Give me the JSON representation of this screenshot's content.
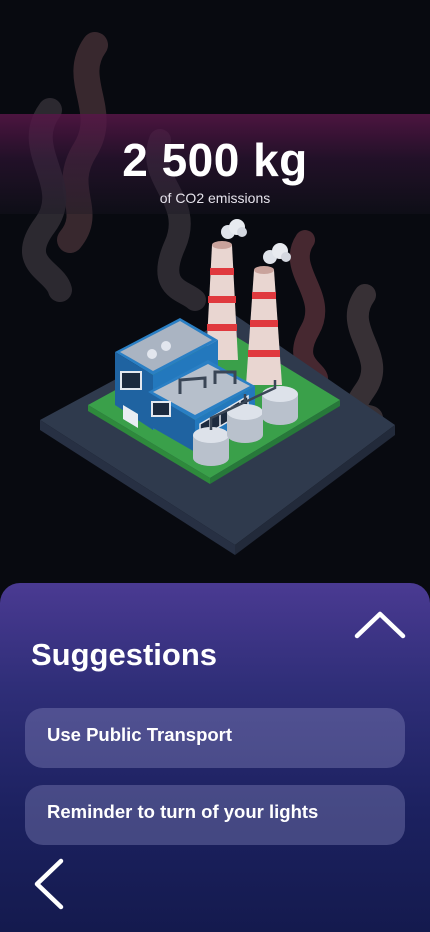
{
  "emission": {
    "value": "2 500 kg",
    "label": "of CO2 emissions"
  },
  "suggestions": {
    "title": "Suggestions",
    "items": [
      {
        "label": "Use Public Transport"
      },
      {
        "label": "Reminder to turn of your lights"
      }
    ]
  },
  "icons": {
    "collapse": "chevron-up-icon",
    "back": "chevron-left-icon",
    "illustration": "factory-illustration"
  },
  "colors": {
    "background": "#080a10",
    "banner": "#58164a",
    "panel_top": "#4a3a92",
    "panel_bottom": "#141a4e",
    "factory_blue": "#1f73b7",
    "grass": "#3aa04a",
    "chimney_stripe": "#e0393e"
  }
}
